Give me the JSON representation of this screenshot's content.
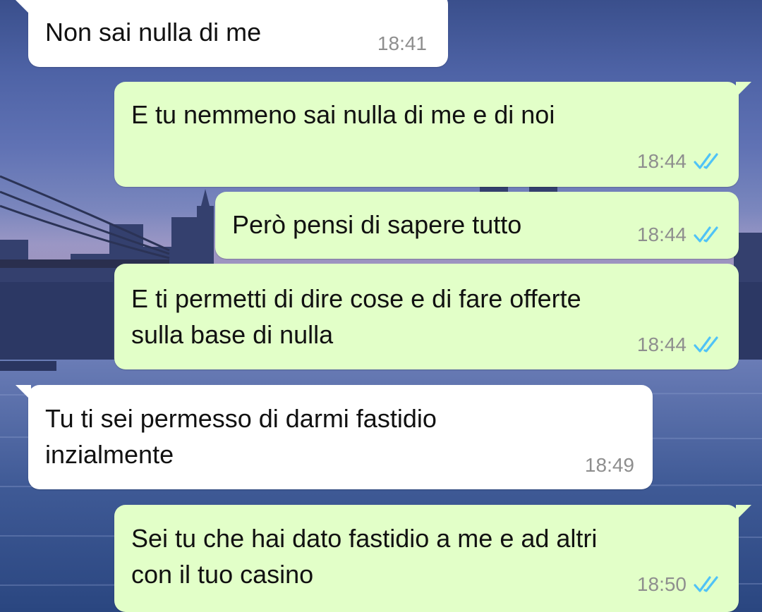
{
  "chat": {
    "messages": [
      {
        "direction": "incoming",
        "text": "Non sai nulla di me",
        "time": "18:41"
      },
      {
        "direction": "outgoing",
        "text": "E tu nemmeno sai nulla di me e di noi",
        "time": "18:44",
        "status_icon": "double-check-read-icon"
      },
      {
        "direction": "outgoing",
        "text": "Però pensi di sapere tutto",
        "time": "18:44",
        "status_icon": "double-check-read-icon"
      },
      {
        "direction": "outgoing",
        "text": "E ti permetti di dire cose e di fare offerte\nsulla base di nulla",
        "time": "18:44",
        "status_icon": "double-check-read-icon"
      },
      {
        "direction": "incoming",
        "text": "Tu ti sei permesso di darmi fastidio\ninzialmente",
        "time": "18:49"
      },
      {
        "direction": "outgoing",
        "text": "Sei tu che hai dato fastidio a me e ad altri\ncon il tuo casino",
        "time": "18:50",
        "status_icon": "double-check-read-icon"
      }
    ]
  },
  "colors": {
    "incoming_bubble": "#ffffff",
    "outgoing_bubble": "#e2ffc8",
    "read_ticks": "#4fc3f7",
    "timestamp": "#8e8e8e"
  }
}
